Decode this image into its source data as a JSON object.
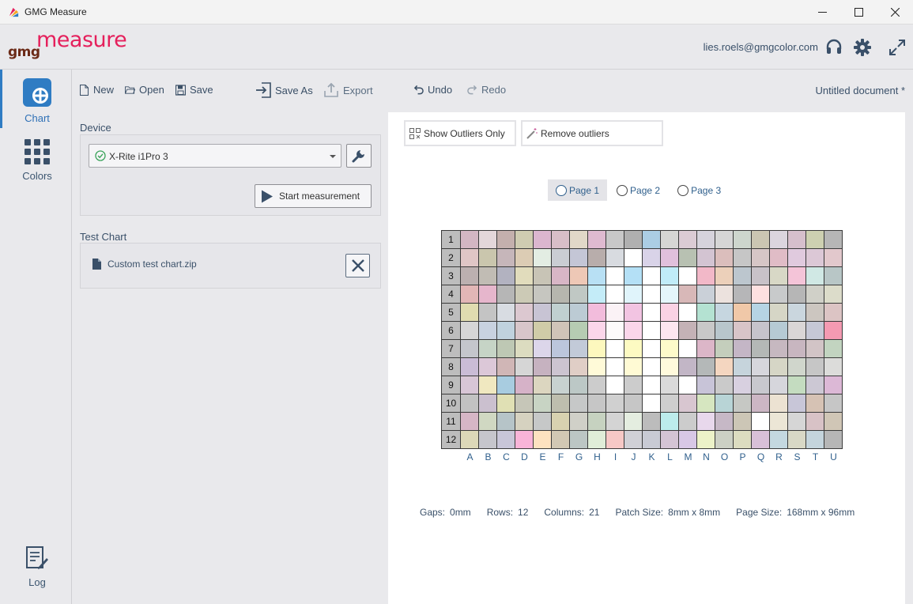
{
  "window": {
    "title": "GMG Measure"
  },
  "header": {
    "logo_gmg": "gmg",
    "logo_measure": "measure",
    "user_email": "lies.roels@gmgcolor.com"
  },
  "rail": {
    "chart": "Chart",
    "colors": "Colors",
    "log": "Log"
  },
  "toolbar": {
    "new": "New",
    "open": "Open",
    "save": "Save",
    "save_as": "Save As",
    "export": "Export",
    "undo": "Undo",
    "redo": "Redo",
    "document_title": "Untitled document *"
  },
  "device": {
    "label": "Device",
    "selected": "X-Rite i1Pro 3",
    "start_measurement": "Start measurement"
  },
  "test_chart": {
    "label": "Test Chart",
    "file": "Custom test chart.zip"
  },
  "outliers": {
    "show_only": "Show Outliers Only",
    "remove": "Remove outliers"
  },
  "pages": [
    {
      "label": "Page 1",
      "selected": true
    },
    {
      "label": "Page 2",
      "selected": false
    },
    {
      "label": "Page 3",
      "selected": false
    }
  ],
  "chart_grid": {
    "columns": [
      "A",
      "B",
      "C",
      "D",
      "E",
      "F",
      "G",
      "H",
      "I",
      "J",
      "K",
      "L",
      "M",
      "N",
      "O",
      "P",
      "Q",
      "R",
      "S",
      "T",
      "U"
    ],
    "rows": [
      "1",
      "2",
      "3",
      "4",
      "5",
      "6",
      "7",
      "8",
      "9",
      "10",
      "11",
      "12"
    ],
    "colors": [
      [
        "#d3b6c3",
        "#e3d7da",
        "#c4b0ad",
        "#cfccb1",
        "#dbb6cf",
        "#d8bec8",
        "#e1d8c8",
        "#dfbad0",
        "#c8c8c8",
        "#b0b0b0",
        "#abcde4",
        "#d6d6d4",
        "#dbcbd4",
        "#d6d3dc",
        "#d6d6d6",
        "#cdd6cd",
        "#cbc6b2",
        "#dbd5de",
        "#d6bfcc",
        "#cdd0b1",
        "#b6b6b6"
      ],
      [
        "#e0c6c6",
        "#cac6ad",
        "#c6b6ba",
        "#dcccb4",
        "#e3ede3",
        "#cacdd3",
        "#c4c6d6",
        "#b8adab",
        "#d8dbe0",
        "#ffffff",
        "#d9d3e8",
        "#e0c0dc",
        "#b8c1b2",
        "#d3c4d2",
        "#dbbebc",
        "#c6c6c6",
        "#d6c6c6",
        "#e0bcc6",
        "#e0cade",
        "#dcc8d6",
        "#e2c8cc"
      ],
      [
        "#bcb0b0",
        "#c1bcb4",
        "#b2b2c0",
        "#e1dcbc",
        "#c8c4b6",
        "#d8b6c6",
        "#eec8b6",
        "#b8e0f4",
        "#ffffff",
        "#b4e0f6",
        "#ffffff",
        "#c0ecf8",
        "#ffffff",
        "#f2b8c8",
        "#ecd0ba",
        "#bcc6ce",
        "#c8c2c8",
        "#d8d8c6",
        "#f4c4d8",
        "#d0e8e4",
        "#b8c6c6"
      ],
      [
        "#e2b6b6",
        "#e6b6cc",
        "#b6b6b6",
        "#cccab6",
        "#c6c6c0",
        "#b6b6ae",
        "#c0c8c4",
        "#c4ecf8",
        "#ffffff",
        "#e0f4fb",
        "#ffffff",
        "#e4f6fb",
        "#d8b8b8",
        "#cad0d8",
        "#ece2de",
        "#b6b6b8",
        "#fde0e0",
        "#c8cacb",
        "#b6b6b6",
        "#d0d0c8",
        "#dcdcca"
      ],
      [
        "#e0dcb0",
        "#c4c4c4",
        "#d8dce2",
        "#dcc8d0",
        "#c8c4d4",
        "#c0d0d0",
        "#bccbd4",
        "#f2bcdc",
        "#fbf2f6",
        "#f2c4e2",
        "#ffffff",
        "#fad2e4",
        "#ffffff",
        "#b4e2d2",
        "#c6d6e0",
        "#f0c8a8",
        "#b6d4e4",
        "#d6d6c6",
        "#cad6de",
        "#ccc6c0",
        "#dcc4c4"
      ],
      [
        "#d6d6d6",
        "#c8d2e0",
        "#c0d2de",
        "#d8c6ca",
        "#d0cca8",
        "#d0c4b8",
        "#b6ccb2",
        "#fbd6ea",
        "#fdfbfb",
        "#fad6ea",
        "#ffffff",
        "#fde6f0",
        "#c4b2b6",
        "#c8c8c8",
        "#b8c6cc",
        "#d8c4c8",
        "#c6c4cc",
        "#b6cad4",
        "#dad6d6",
        "#c6c8d6",
        "#f49ab2"
      ],
      [
        "#c4c6cc",
        "#c6d4c6",
        "#bec8b4",
        "#dcdcc0",
        "#dcd6ea",
        "#bcc6dc",
        "#c2cad8",
        "#fdf8be",
        "#ffffff",
        "#fdfac2",
        "#ffffff",
        "#fdfbca",
        "#ffffff",
        "#dcb6c8",
        "#c4cebc",
        "#c4b6c6",
        "#b4b8b6",
        "#c6b8c0",
        "#c8b6c0",
        "#d2c4c6",
        "#c2d4c0"
      ],
      [
        "#cabcd6",
        "#dcc8d8",
        "#d0b6b6",
        "#d6d6d6",
        "#c6b2c0",
        "#ccc4d0",
        "#e0cec6",
        "#fffad8",
        "#ffffff",
        "#fffad4",
        "#ffffff",
        "#fffadc",
        "#c2b6c6",
        "#b4b8b8",
        "#f4d6c0",
        "#c6d4dc",
        "#d6d6dc",
        "#d6d6c6",
        "#d0d6cc",
        "#c6c6c6",
        "#dcdcda"
      ],
      [
        "#d8c6d6",
        "#f0e8c0",
        "#a8cce0",
        "#d6b2c8",
        "#dcd6c0",
        "#c8d2d0",
        "#bcc8c6",
        "#cccccc",
        "#ffffff",
        "#cccccc",
        "#ffffff",
        "#dadada",
        "#ffffff",
        "#c8c4d8",
        "#cacaca",
        "#d8d0e0",
        "#c8c8ce",
        "#d6d6dc",
        "#c4dcc0",
        "#ccc8d4",
        "#dcb8d6"
      ],
      [
        "#c2c2c2",
        "#cbc0cf",
        "#e0e0b4",
        "#c6c6b8",
        "#c8d4c4",
        "#bebeae",
        "#c6c8c8",
        "#c6c6c6",
        "#d0d0d0",
        "#c6c6c6",
        "#ffffff",
        "#cecece",
        "#d8c6d0",
        "#d6e6c0",
        "#b8d4d6",
        "#c6c8c4",
        "#ccb6c4",
        "#ece2d2",
        "#c8c6d8",
        "#d6c2b4",
        "#c6c6c6"
      ],
      [
        "#d6b6c6",
        "#d0d8c2",
        "#b6c4c8",
        "#d6d2c0",
        "#c6c8c8",
        "#d8d2b0",
        "#d0d0c8",
        "#c6d2c0",
        "#d4d4d4",
        "#e4ede0",
        "#bcbcbc",
        "#bcecec",
        "#cccccc",
        "#e8d8ec",
        "#c6b8c6",
        "#ccc6b6",
        "#ffffff",
        "#ece6d6",
        "#d6d6d6",
        "#d8c2c6",
        "#d0c6b6"
      ],
      [
        "#dcd8b8",
        "#c6c6cc",
        "#c8c6d8",
        "#f8b4d8",
        "#fde2c0",
        "#d2c8b4",
        "#bcc6c4",
        "#e0edd8",
        "#f6c8c6",
        "#d0d0d6",
        "#c8cad4",
        "#d4c4d4",
        "#d8c8e6",
        "#ecf2c8",
        "#ccd0c4",
        "#dcdcc0",
        "#d8c0d8",
        "#c4d8e0",
        "#d8d8c6",
        "#c4d4dc",
        "#b6b6b6"
      ]
    ]
  },
  "info": {
    "gaps_label": "Gaps:",
    "gaps_value": "0mm",
    "rows_label": "Rows:",
    "rows_value": "12",
    "columns_label": "Columns:",
    "columns_value": "21",
    "patch_label": "Patch Size:",
    "patch_value": "8mm x 8mm",
    "page_label": "Page Size:",
    "page_value": "168mm x 96mm"
  },
  "colors": {
    "accent": "#2f7cc3",
    "brand_pink": "#e5205c",
    "brand_brown": "#6b2a17",
    "text_blue": "#3a5069"
  }
}
